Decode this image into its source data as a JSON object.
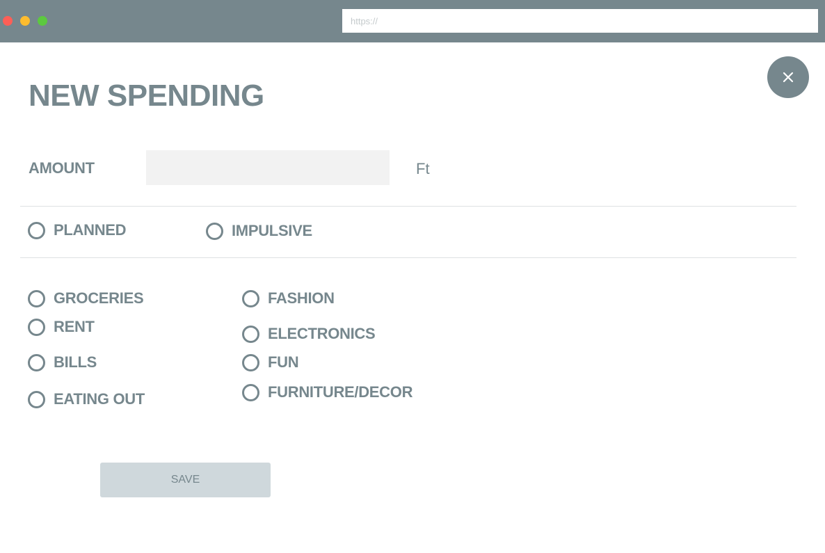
{
  "browser": {
    "url_placeholder": "https://",
    "traffic_lights": [
      {
        "name": "close",
        "color": "#fe5f57"
      },
      {
        "name": "minimize",
        "color": "#febc2e"
      },
      {
        "name": "zoom",
        "color": "#5cc93f"
      }
    ]
  },
  "colors": {
    "accent": "#76878d",
    "input_bg": "#f2f2f2",
    "save_bg": "#cfd8dc"
  },
  "close_icon": "close-icon",
  "form": {
    "title": "NEW SPENDING",
    "amount_label": "AMOUNT",
    "amount_value": "",
    "currency": "Ft",
    "type_options": [
      "PLANNED",
      "IMPULSIVE"
    ],
    "categories": {
      "column_1": [
        "GROCERIES",
        "RENT",
        "BILLS",
        "EATING OUT"
      ],
      "column_2": [
        "FASHION",
        "ELECTRONICS",
        "FUN",
        "FURNITURE/DECOR"
      ]
    },
    "save_label": "SAVE"
  }
}
